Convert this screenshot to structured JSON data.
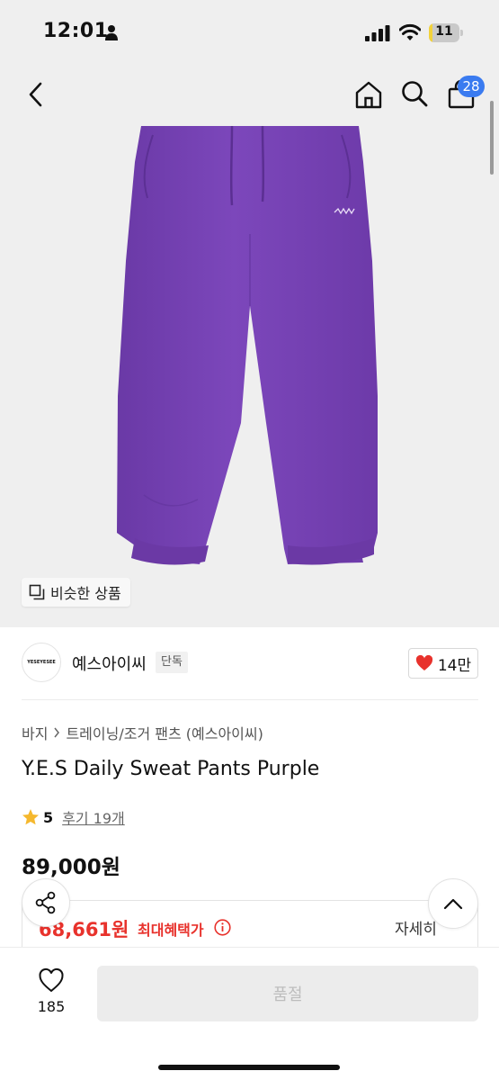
{
  "status_bar": {
    "time": "12:01",
    "battery": "11",
    "battery_level": 0.11,
    "icons": [
      "person-icon",
      "signal-icon",
      "wifi-icon",
      "battery-icon"
    ]
  },
  "nav": {
    "icons": [
      "back-icon",
      "home-icon",
      "search-icon",
      "bag-icon"
    ],
    "cart_count": "28"
  },
  "product_image": {
    "similar_label": "비슷한 상품",
    "garment_color": "#7a44b8"
  },
  "brand": {
    "logo_text": "YESEYESEE",
    "name": "예스아이씨",
    "exclusive": "단독",
    "likes": "14만"
  },
  "breadcrumb": {
    "category": "바지",
    "subcategory": "트레이닝/조거 팬츠 (예스아이씨)"
  },
  "product": {
    "title": "Y.E.S Daily Sweat Pants Purple",
    "rating": "5",
    "reviews": "후기 19개",
    "price": "89,000원"
  },
  "benefit": {
    "price": "68,661원",
    "label": "최대혜택가",
    "detail": "자세히"
  },
  "bottom_bar": {
    "wish_count": "185",
    "buy_label": "품절"
  },
  "colors": {
    "accent_red": "#e8322c",
    "badge_blue": "#3a7bf0",
    "star": "#f5b82e"
  }
}
